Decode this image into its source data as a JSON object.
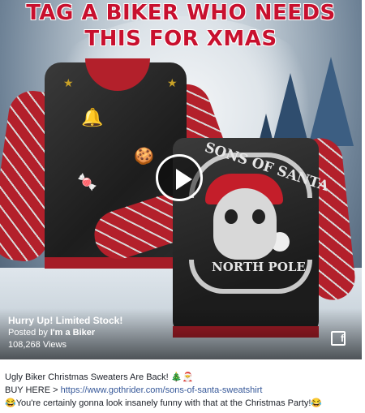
{
  "video": {
    "headline": "TAG A BIKER WHO NEEDS THIS FOR XMAS",
    "patch_top": "SONS OF SANTA",
    "patch_bottom": "NORTH POLE",
    "overlay_title": "Hurry Up! Limited Stock!",
    "posted_by_prefix": "Posted by",
    "posted_by_name": "I'm a Biker",
    "views": "108,268 Views",
    "icons": [
      "play-icon",
      "facebook-icon"
    ]
  },
  "post": {
    "line1": "Ugly Biker Christmas Sweaters Are Back!",
    "line1_emojis": "🎄🎅",
    "line2_prefix": "BUY HERE >",
    "line2_link": "https://www.gothrider.com/sons-of-santa-sweatshirt",
    "line3": "You're certainly gonna look insanely funny with that at the Christmas Party!",
    "line3_emoji": "😂"
  },
  "colors": {
    "headline_red": "#c8102e",
    "link_blue": "#365899",
    "sweater_red": "#b3202b"
  }
}
